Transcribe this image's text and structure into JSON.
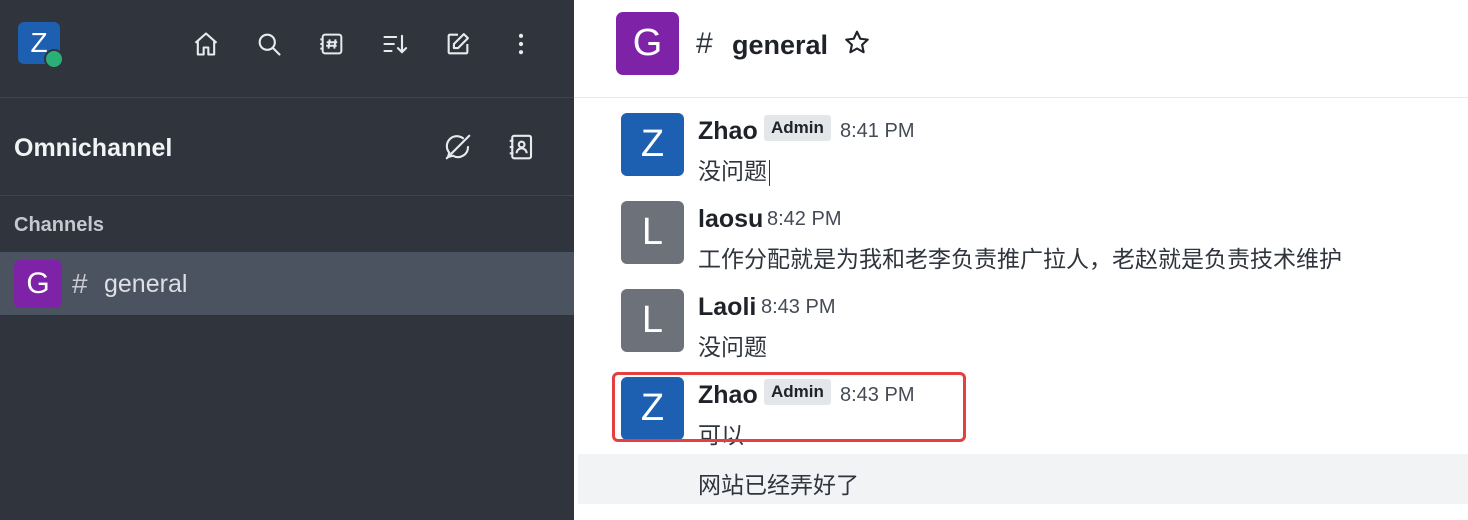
{
  "user": {
    "initial": "Z"
  },
  "sidebar": {
    "omnichannel_title": "Omnichannel",
    "section_label": "Channels",
    "channels": [
      {
        "initial": "G",
        "name": "general"
      }
    ]
  },
  "room": {
    "initial": "G",
    "name": "general",
    "hash": "#"
  },
  "colors": {
    "accent_purple": "#7e23a7",
    "accent_blue": "#1d5fb0",
    "gray_avatar": "#6c717a",
    "online": "#2ab077",
    "highlight_red": "#e53f3f"
  },
  "messages": [
    {
      "initial": "Z",
      "name": "Zhao",
      "badge": "Admin",
      "time": "8:41 PM",
      "text": "没问题"
    },
    {
      "initial": "L",
      "name": "laosu",
      "time": "8:42 PM",
      "text": "工作分配就是为我和老李负责推广拉人，老赵就是负责技术维护"
    },
    {
      "initial": "L",
      "name": "Laoli",
      "time": "8:43 PM",
      "text": "没问题"
    },
    {
      "initial": "Z",
      "name": "Zhao",
      "badge": "Admin",
      "time": "8:43 PM",
      "text": "可以"
    }
  ],
  "follow_up": {
    "text": "网站已经弄好了"
  }
}
